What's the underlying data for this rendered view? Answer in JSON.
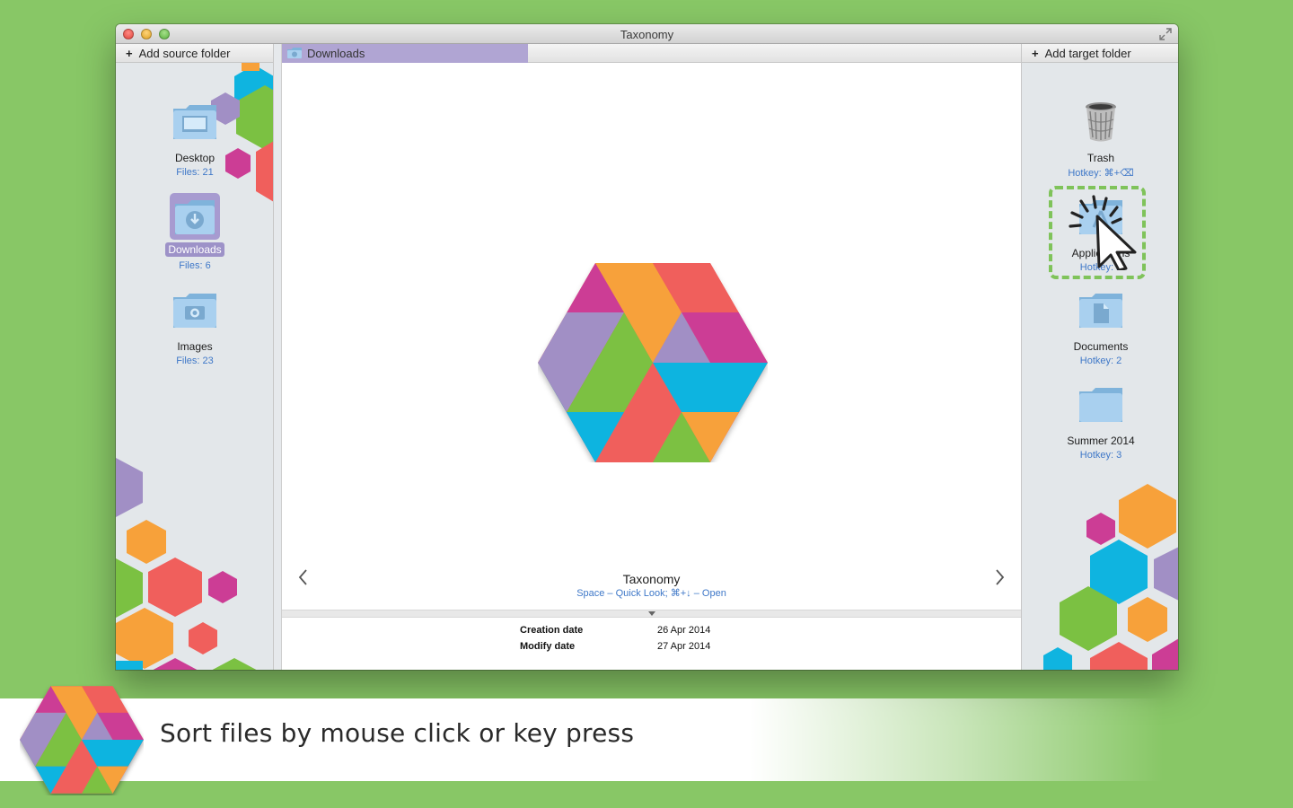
{
  "window": {
    "title": "Taxonomy"
  },
  "left_panel": {
    "header_label": "Add source folder",
    "items": [
      {
        "name": "Desktop",
        "meta": "Files: 21",
        "icon": "desktop-folder-icon",
        "selected": false
      },
      {
        "name": "Downloads",
        "meta": "Files: 6",
        "icon": "downloads-folder-icon",
        "selected": true
      },
      {
        "name": "Images",
        "meta": "Files: 23",
        "icon": "pictures-folder-icon",
        "selected": false
      }
    ]
  },
  "center": {
    "path_label": "Downloads",
    "file_name": "Taxonomy",
    "hint": "Space – Quick Look; ⌘+↓ – Open",
    "prev_icon": "chevron-left-icon",
    "next_icon": "chevron-right-icon",
    "info": [
      {
        "label": "Creation date",
        "value": "26 Apr 2014"
      },
      {
        "label": "Modify date",
        "value": "27 Apr 2014"
      }
    ]
  },
  "right_panel": {
    "header_label": "Add target folder",
    "items": [
      {
        "name": "Trash",
        "meta": "Hotkey: ⌘+⌫",
        "icon": "trash-icon"
      },
      {
        "name": "Applications",
        "meta": "Hotkey: 1",
        "icon": "applications-folder-icon"
      },
      {
        "name": "Documents",
        "meta": "Hotkey: 2",
        "icon": "documents-folder-icon"
      },
      {
        "name": "Summer 2014",
        "meta": "Hotkey: 3",
        "icon": "folder-icon"
      }
    ]
  },
  "banner": {
    "text": "Sort files by mouse click or key press"
  },
  "colors": {
    "background": "#88c766",
    "accent_purple": "#9d92c8",
    "link_blue": "#3f78c8",
    "hex_orange": "#f7a13a",
    "hex_red": "#f05f5c",
    "hex_magenta": "#cc3d95",
    "hex_cyan": "#0fb4e0",
    "hex_green": "#7bc142",
    "hex_lavender": "#a18fc5"
  }
}
